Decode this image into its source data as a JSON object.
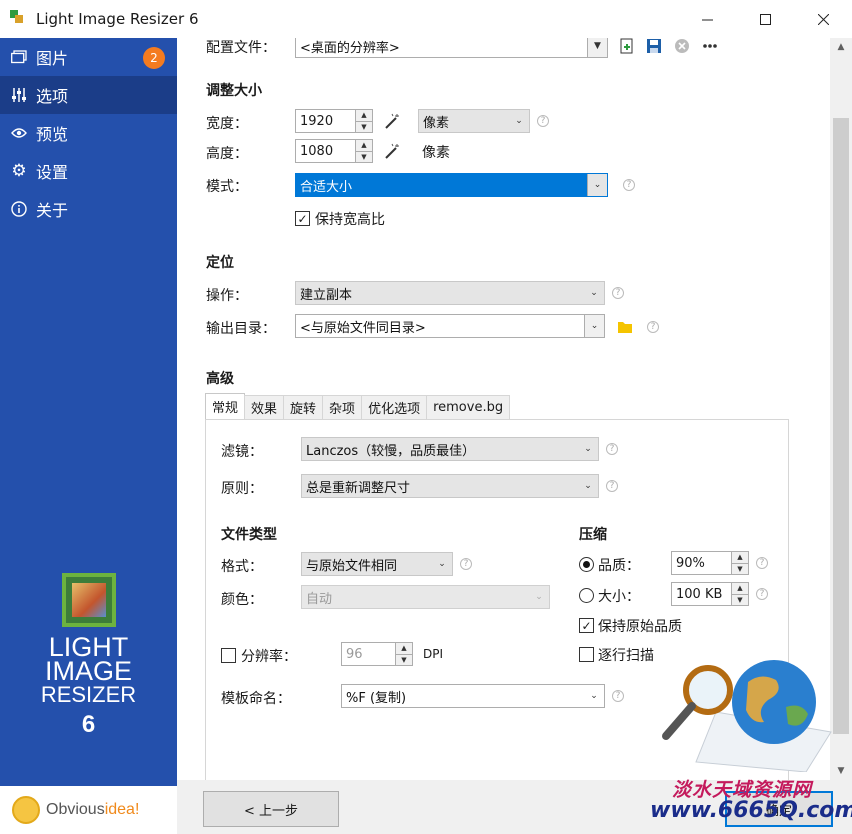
{
  "window": {
    "title": "Light Image Resizer 6"
  },
  "sidebar": {
    "items": [
      {
        "label": "图片",
        "icon": "images-icon",
        "badge": "2"
      },
      {
        "label": "选项",
        "icon": "sliders-icon"
      },
      {
        "label": "预览",
        "icon": "eye-icon"
      },
      {
        "label": "设置",
        "icon": "gear-icon"
      },
      {
        "label": "关于",
        "icon": "info-icon"
      }
    ],
    "brand": {
      "line1": "LIGHT",
      "line2": "IMAGE",
      "line3": "RESIZER",
      "version": "6"
    },
    "vendor": {
      "name_part1": "Obvious",
      "name_part2": "idea!"
    }
  },
  "profile": {
    "label": "配置文件：",
    "value": "<桌面的分辨率>"
  },
  "resize": {
    "title": "调整大小",
    "width_label": "宽度：",
    "width_value": "1920",
    "height_label": "高度：",
    "height_value": "1080",
    "unit_value": "像素",
    "unit_text": "像素",
    "mode_label": "模式：",
    "mode_value": "合适大小",
    "keep_ratio_label": "保持宽高比"
  },
  "position": {
    "title": "定位",
    "action_label": "操作：",
    "action_value": "建立副本",
    "output_label": "输出目录：",
    "output_value": "<与原始文件同目录>"
  },
  "advanced": {
    "title": "高级",
    "tabs": [
      "常规",
      "效果",
      "旋转",
      "杂项",
      "优化选项",
      "remove.bg"
    ],
    "filter_label": "滤镜：",
    "filter_value": "Lanczos（较慢，品质最佳）",
    "rule_label": "原则：",
    "rule_value": "总是重新调整尺寸",
    "filetype_title": "文件类型",
    "format_label": "格式：",
    "format_value": "与原始文件相同",
    "color_label": "颜色：",
    "color_value": "自动",
    "resolution_label": "分辨率：",
    "resolution_value": "96",
    "resolution_unit": "DPI",
    "template_label": "模板命名：",
    "template_value": "%F (复制)",
    "compress_title": "压缩",
    "quality_label": "品质：",
    "quality_value": "90%",
    "size_label": "大小：",
    "size_value": "100 KB",
    "keep_quality_label": "保持原始品质",
    "progressive_label": "逐行扫描"
  },
  "footer": {
    "back_label": "< 上一步",
    "next_label": "确定"
  },
  "watermark": {
    "text": "淡水天域资源网",
    "url": "www.6665Q.com"
  }
}
